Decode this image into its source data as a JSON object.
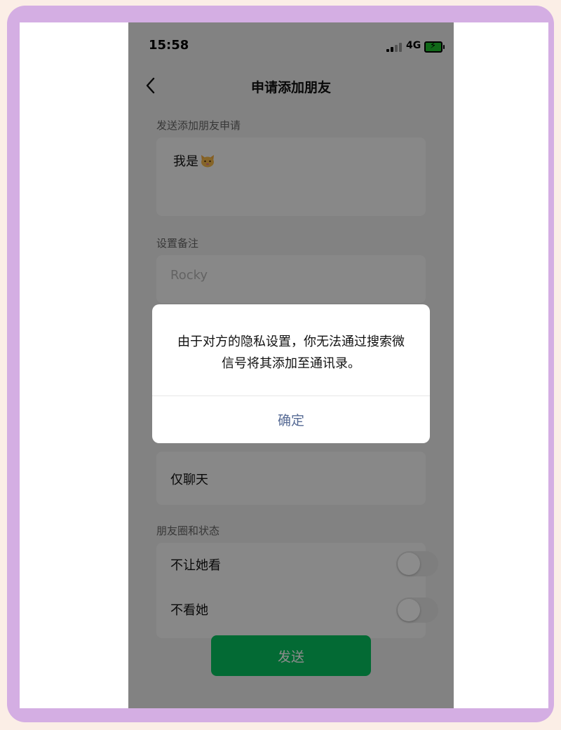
{
  "status_bar": {
    "time": "15:58",
    "network": "4G"
  },
  "nav": {
    "title": "申请添加朋友"
  },
  "request_section": {
    "label": "发送添加朋友申请",
    "message": "我是"
  },
  "remark_section": {
    "label": "设置备注",
    "placeholder": "Rocky"
  },
  "permission": {
    "selected_option": "仅聊天"
  },
  "moments_section": {
    "label": "朋友圈和状态",
    "hide_from_her": {
      "label": "不让她看",
      "on": false
    },
    "hide_her": {
      "label": "不看她",
      "on": false
    }
  },
  "send_button": {
    "label": "发送"
  },
  "dialog": {
    "message": "由于对方的隐私设置，你无法通过搜索微信号将其添加至通讯录。",
    "confirm_label": "确定"
  },
  "colors": {
    "brand_green": "#07c160",
    "dialog_link": "#576b95",
    "frame_purple": "#d4aee3",
    "background_peach": "#fbeee6"
  }
}
